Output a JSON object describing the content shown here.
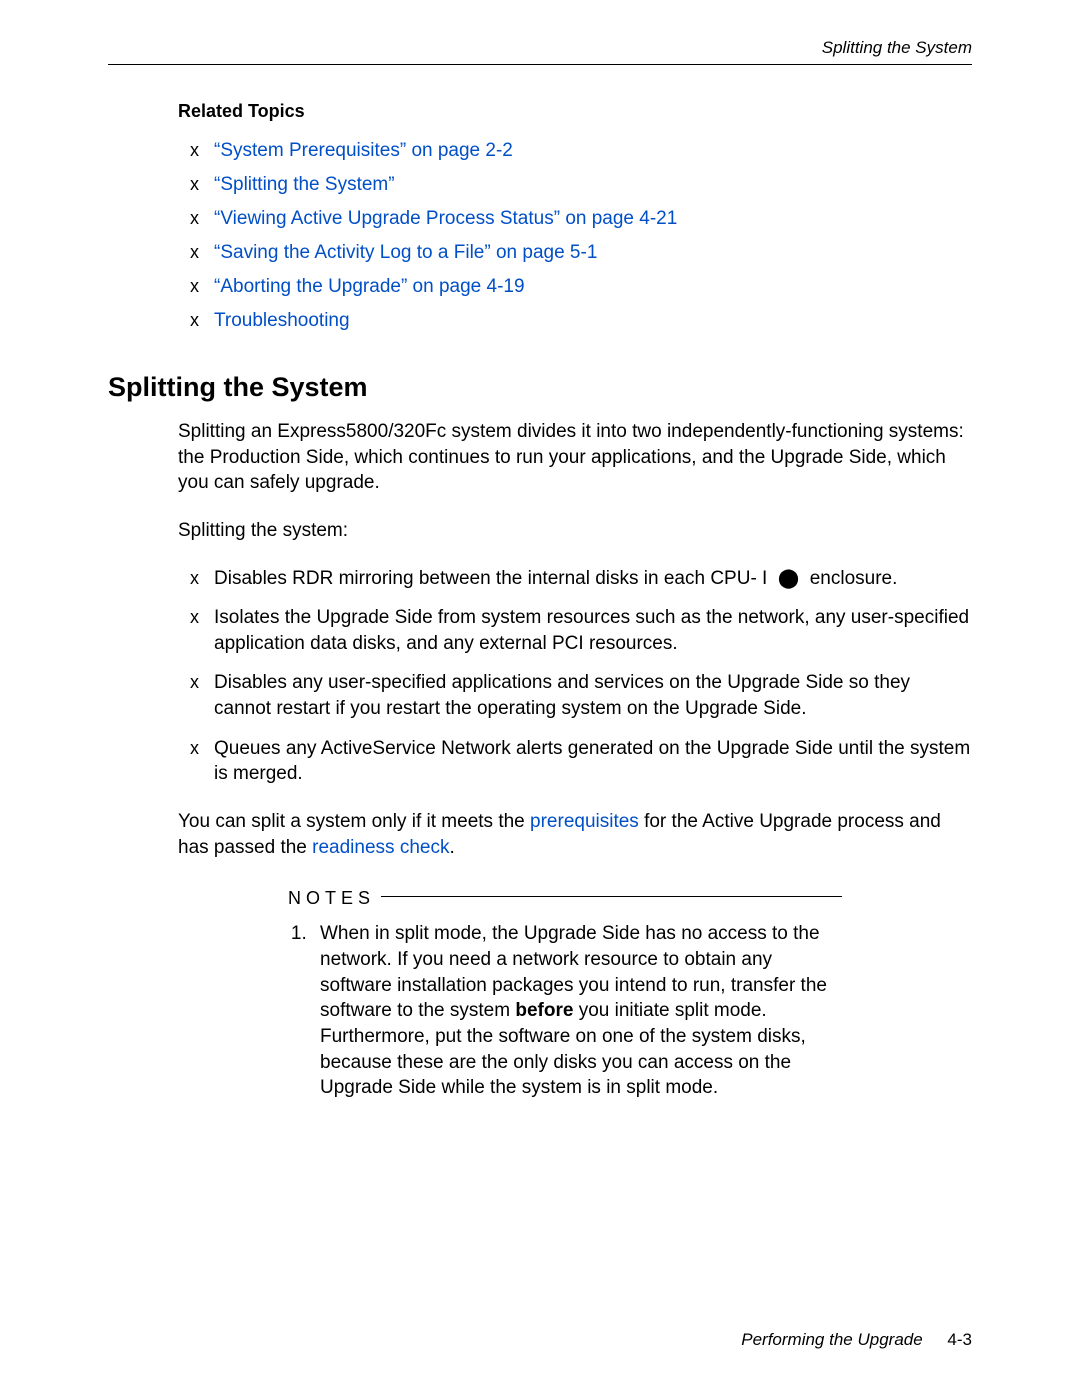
{
  "header": {
    "section_title": "Splitting the System"
  },
  "related_topics": {
    "heading": "Related Topics",
    "items": [
      "“System Prerequisites” on page 2-2",
      "“Splitting the System”",
      "“Viewing Active Upgrade Process Status” on page 4-21",
      "“Saving the Activity Log to a File” on page 5-1",
      "“Aborting the Upgrade” on page 4-19",
      "Troubleshooting"
    ]
  },
  "main": {
    "heading": "Splitting the System",
    "intro": "Splitting an Express5800/320Fc system divides it into two independently-functioning systems: the Production Side, which continues to run your applications, and the Upgrade Side, which you can safely upgrade.",
    "lead": "Splitting the system:",
    "bullets": [
      "Disables RDR mirroring between the internal disks in each CPU- I  ⬤  enclosure.",
      "Isolates the Upgrade Side from system resources such as the network, any user-specified application data disks, and any external PCI resources.",
      "Disables any user-specified applications and services on the Upgrade Side so they cannot restart if you restart the operating system on the Upgrade Side.",
      "Queues any ActiveService Network alerts generated on the Upgrade Side until the system is merged."
    ],
    "after_bullets_pre": "You can split a system only if it meets the ",
    "link_prereq": "prerequisites",
    "after_bullets_mid": " for the Active Upgrade process and has passed the ",
    "link_readiness": "readiness check",
    "after_bullets_post": "."
  },
  "notes": {
    "label": "NOTES",
    "item1_pre": "When in split mode, the Upgrade Side has no access to the network. If you need a network resource to obtain any software installation packages you intend to run, transfer the software to the system ",
    "item1_bold": "before",
    "item1_post": " you initiate split mode. Furthermore, put the software on one of the system disks, because these are the only disks you can access on the Upgrade Side while the system is in split mode."
  },
  "footer": {
    "chapter": "Performing the Upgrade",
    "page": "4-3"
  }
}
